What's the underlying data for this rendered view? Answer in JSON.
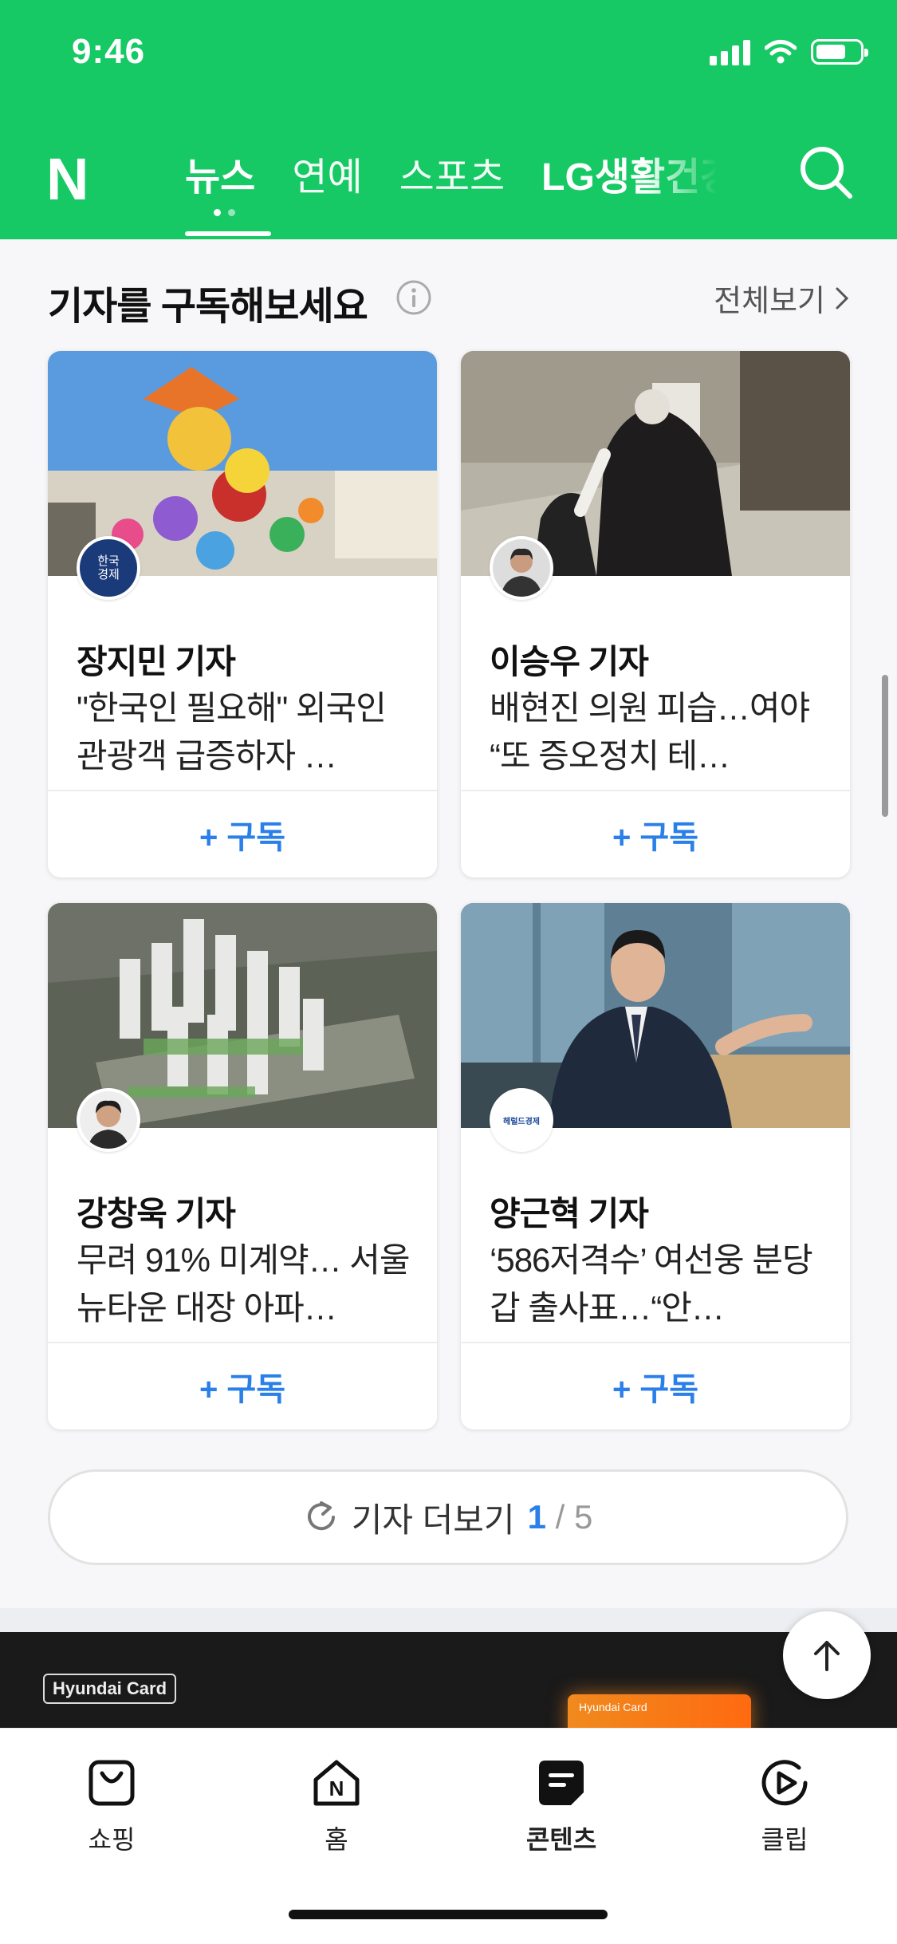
{
  "status_bar": {
    "time": "9:46"
  },
  "header": {
    "logo": "N",
    "tabs": [
      {
        "label": "뉴스",
        "active": true
      },
      {
        "label": "연예",
        "active": false
      },
      {
        "label": "스포츠",
        "active": false
      },
      {
        "label": "LG생활건강",
        "active": false
      }
    ],
    "search_icon": "search-icon",
    "brand_color": "#16c964"
  },
  "section": {
    "title": "기자를 구독해보세요",
    "info_icon": "info-icon",
    "see_all_label": "전체보기"
  },
  "cards": [
    {
      "reporter": "장지민 기자",
      "headline": "\"한국인 필요해\" 외국인 관광객 급증하자 …",
      "subscribe_label": "+ 구독",
      "avatar_text_1": "한국",
      "avatar_text_2": "경제"
    },
    {
      "reporter": "이승우 기자",
      "headline": "배현진 의원 피습…여야 “또 증오정치 테…",
      "subscribe_label": "+ 구독"
    },
    {
      "reporter": "강창욱 기자",
      "headline": "무려 91% 미계약… 서울 뉴타운 대장 아파…",
      "subscribe_label": "+ 구독"
    },
    {
      "reporter": "양근혁 기자",
      "headline": "‘586저격수’ 여선웅 분당갑 출사표…“안…",
      "subscribe_label": "+ 구독",
      "avatar_text_1": "헤럴드경제"
    }
  ],
  "more_button": {
    "label": "기자 더보기",
    "current": "1",
    "separator": "/",
    "total": "5"
  },
  "ad": {
    "brand": "Hyundai Card",
    "card_label": "Hyundai Card"
  },
  "bottom_nav": [
    {
      "label": "쇼핑",
      "icon": "shopping-bag-icon"
    },
    {
      "label": "홈",
      "icon": "home-icon"
    },
    {
      "label": "콘텐츠",
      "icon": "contents-icon",
      "active": true
    },
    {
      "label": "클립",
      "icon": "clip-play-icon"
    }
  ],
  "accent_color": "#2a7fe8"
}
